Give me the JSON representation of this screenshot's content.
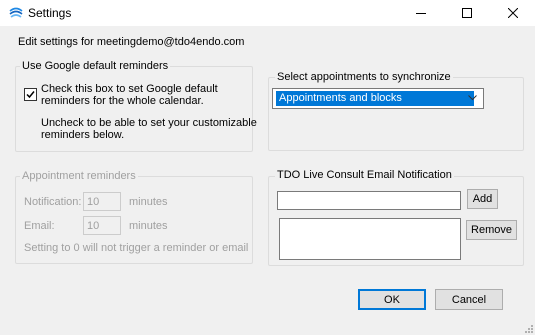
{
  "window": {
    "title": "Settings",
    "icon": "app-icon",
    "controls": [
      "minimize-icon",
      "maximize-icon",
      "close-icon"
    ]
  },
  "header": {
    "edit_settings_text": "Edit settings for meetingdemo@tdo4endo.com"
  },
  "google_reminders": {
    "legend": "Use Google default reminders",
    "checkbox_checked": true,
    "checkbox_label_line1": "Check this box to set Google default",
    "checkbox_label_line2": "reminders for the whole calendar.",
    "uncheck_text_line1": "Uncheck to be able to set your customizable",
    "uncheck_text_line2": "reminders below."
  },
  "sync": {
    "legend": "Select appointments to synchronize",
    "selected_value": "Appointments and blocks"
  },
  "appointment_reminders": {
    "legend": "Appointment reminders",
    "notification_label": "Notification:",
    "notification_value": "10",
    "notification_unit": "minutes",
    "email_label": "Email:",
    "email_value": "10",
    "email_unit": "minutes",
    "note": "Setting to 0 will not trigger a reminder or email"
  },
  "tdo_notification": {
    "legend": "TDO Live Consult Email Notification",
    "email_input_value": "",
    "add_label": "Add",
    "remove_label": "Remove"
  },
  "footer": {
    "ok_label": "OK",
    "cancel_label": "Cancel"
  },
  "colors": {
    "accent": "#0078d7",
    "disabled_text": "#a0a0a0"
  }
}
